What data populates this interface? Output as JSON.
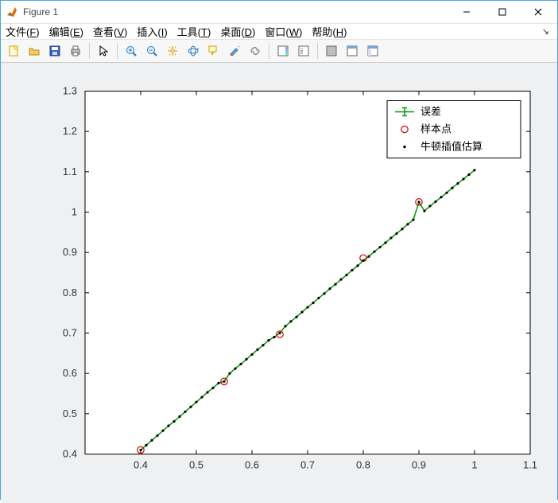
{
  "window": {
    "title": "Figure 1"
  },
  "menu": {
    "items": [
      {
        "label": "文件(F)",
        "key": "F"
      },
      {
        "label": "编辑(E)",
        "key": "E"
      },
      {
        "label": "查看(V)",
        "key": "V"
      },
      {
        "label": "插入(I)",
        "key": "I"
      },
      {
        "label": "工具(T)",
        "key": "T"
      },
      {
        "label": "桌面(D)",
        "key": "D"
      },
      {
        "label": "窗口(W)",
        "key": "W"
      },
      {
        "label": "帮助(H)",
        "key": "H"
      }
    ]
  },
  "toolbar": {
    "buttons": [
      "new-figure",
      "open",
      "save",
      "print",
      "sep",
      "pointer",
      "sep",
      "zoom-in",
      "zoom-out",
      "pan",
      "rotate3d",
      "datatip",
      "brush",
      "link",
      "sep",
      "colorbar",
      "legend",
      "sep",
      "hide-tools",
      "dock",
      "app-layout"
    ]
  },
  "legend": {
    "entries": [
      {
        "label": "误差",
        "marker": "errorbar",
        "color": "#009900"
      },
      {
        "label": "样本点",
        "marker": "circle",
        "color": "#cc0000"
      },
      {
        "label": "牛顿插值估算",
        "marker": "dot",
        "color": "#000000"
      }
    ]
  },
  "chart_data": {
    "type": "scatter",
    "xlabel": "",
    "ylabel": "",
    "xlim": [
      0.3,
      1.1
    ],
    "ylim": [
      0.4,
      1.3
    ],
    "xticks": [
      0.4,
      0.5,
      0.6,
      0.7,
      0.8,
      0.9,
      1,
      1.1
    ],
    "yticks": [
      0.4,
      0.5,
      0.6,
      0.7,
      0.8,
      0.9,
      1,
      1.1,
      1.2,
      1.3
    ],
    "series": [
      {
        "name": "误差",
        "type": "errorbar-line",
        "color": "#009900",
        "x": [
          0.4,
          0.41,
          0.42,
          0.43,
          0.44,
          0.45,
          0.46,
          0.47,
          0.48,
          0.49,
          0.5,
          0.51,
          0.52,
          0.53,
          0.54,
          0.55,
          0.56,
          0.57,
          0.58,
          0.59,
          0.6,
          0.61,
          0.62,
          0.63,
          0.64,
          0.65,
          0.66,
          0.67,
          0.68,
          0.69,
          0.7,
          0.71,
          0.72,
          0.73,
          0.74,
          0.75,
          0.76,
          0.77,
          0.78,
          0.79,
          0.8,
          0.81,
          0.82,
          0.83,
          0.84,
          0.85,
          0.86,
          0.87,
          0.88,
          0.89,
          0.9,
          0.91,
          0.92,
          0.93,
          0.94,
          0.95,
          0.96,
          0.97,
          0.98,
          0.99,
          1.0
        ],
        "y": [
          0.41,
          0.422,
          0.434,
          0.446,
          0.458,
          0.47,
          0.481,
          0.493,
          0.505,
          0.517,
          0.529,
          0.541,
          0.553,
          0.564,
          0.576,
          0.58,
          0.6,
          0.612,
          0.623,
          0.635,
          0.647,
          0.659,
          0.67,
          0.682,
          0.69,
          0.7,
          0.717,
          0.729,
          0.74,
          0.752,
          0.764,
          0.775,
          0.787,
          0.798,
          0.81,
          0.821,
          0.833,
          0.844,
          0.856,
          0.867,
          0.88,
          0.89,
          0.902,
          0.913,
          0.924,
          0.936,
          0.947,
          0.958,
          0.97,
          0.981,
          1.025,
          1.003,
          1.015,
          1.026,
          1.037,
          1.048,
          1.06,
          1.071,
          1.082,
          1.093,
          1.104
        ]
      },
      {
        "name": "样本点",
        "type": "scatter-open-circle",
        "color": "#cc0000",
        "x": [
          0.4,
          0.55,
          0.65,
          0.8,
          0.9
        ],
        "y": [
          0.41,
          0.58,
          0.697,
          0.886,
          1.025
        ]
      },
      {
        "name": "牛顿插值估算",
        "type": "scatter-dot",
        "color": "#000000",
        "x": [
          0.4,
          0.41,
          0.42,
          0.43,
          0.44,
          0.45,
          0.46,
          0.47,
          0.48,
          0.49,
          0.5,
          0.51,
          0.52,
          0.53,
          0.54,
          0.55,
          0.56,
          0.57,
          0.58,
          0.59,
          0.6,
          0.61,
          0.62,
          0.63,
          0.64,
          0.65,
          0.66,
          0.67,
          0.68,
          0.69,
          0.7,
          0.71,
          0.72,
          0.73,
          0.74,
          0.75,
          0.76,
          0.77,
          0.78,
          0.79,
          0.8,
          0.81,
          0.82,
          0.83,
          0.84,
          0.85,
          0.86,
          0.87,
          0.88,
          0.89,
          0.9,
          0.91,
          0.92,
          0.93,
          0.94,
          0.95,
          0.96,
          0.97,
          0.98,
          0.99,
          1.0
        ],
        "y": [
          0.41,
          0.422,
          0.434,
          0.446,
          0.458,
          0.47,
          0.481,
          0.493,
          0.505,
          0.517,
          0.529,
          0.541,
          0.553,
          0.564,
          0.576,
          0.58,
          0.6,
          0.612,
          0.623,
          0.635,
          0.647,
          0.659,
          0.67,
          0.682,
          0.69,
          0.7,
          0.717,
          0.729,
          0.74,
          0.752,
          0.764,
          0.775,
          0.787,
          0.798,
          0.81,
          0.821,
          0.833,
          0.844,
          0.856,
          0.867,
          0.88,
          0.89,
          0.902,
          0.913,
          0.924,
          0.936,
          0.947,
          0.958,
          0.97,
          0.981,
          1.025,
          1.003,
          1.015,
          1.026,
          1.037,
          1.048,
          1.06,
          1.071,
          1.082,
          1.093,
          1.104
        ]
      }
    ]
  }
}
